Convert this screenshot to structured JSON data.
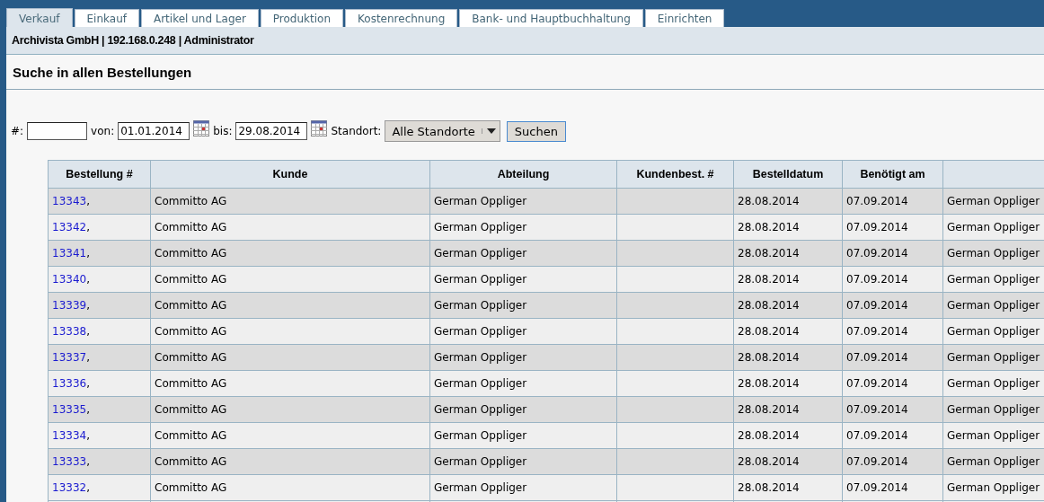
{
  "tabs": [
    {
      "label": "Verkauf",
      "selected": true
    },
    {
      "label": "Einkauf",
      "selected": false
    },
    {
      "label": "Artikel und Lager",
      "selected": false
    },
    {
      "label": "Produktion",
      "selected": false
    },
    {
      "label": "Kostenrechnung",
      "selected": false
    },
    {
      "label": "Bank- und Hauptbuchhaltung",
      "selected": false
    },
    {
      "label": "Einrichten",
      "selected": false
    }
  ],
  "info_bar": "Archivista GmbH | 192.168.0.248 | Administrator",
  "page_title": "Suche in allen Bestellungen",
  "search_form": {
    "number_label": "#:",
    "from_label": "von:",
    "from_value": "01.01.2014",
    "to_label": "bis:",
    "to_value": "29.08.2014",
    "location_label": "Standort:",
    "location_value": "Alle Standorte",
    "search_button": "Suchen"
  },
  "table": {
    "columns": [
      "Bestellung #",
      "Kunde",
      "Abteilung",
      "Kundenbest. #",
      "Bestelldatum",
      "Benötigt am"
    ],
    "rows": [
      {
        "number": "13343",
        "separator": ",",
        "customer": "Committo AG",
        "department": "German Oppliger",
        "order_date": "28.08.2014",
        "needed_by": "07.09.2014",
        "column_7": "German Oppliger"
      },
      {
        "number": "13342",
        "separator": ",",
        "customer": "Committo AG",
        "department": "German Oppliger",
        "order_date": "28.08.2014",
        "needed_by": "07.09.2014",
        "column_7": "German Oppliger"
      },
      {
        "number": "13341",
        "separator": ",",
        "customer": "Committo AG",
        "department": "German Oppliger",
        "order_date": "28.08.2014",
        "needed_by": "07.09.2014",
        "column_7": "German Oppliger"
      },
      {
        "number": "13340",
        "separator": ",",
        "customer": "Committo AG",
        "department": "German Oppliger",
        "order_date": "28.08.2014",
        "needed_by": "07.09.2014",
        "column_7": "German Oppliger"
      },
      {
        "number": "13339",
        "separator": ",",
        "customer": "Committo AG",
        "department": "German Oppliger",
        "order_date": "28.08.2014",
        "needed_by": "07.09.2014",
        "column_7": "German Oppliger"
      },
      {
        "number": "13338",
        "separator": ",",
        "customer": "Committo AG",
        "department": "German Oppliger",
        "order_date": "28.08.2014",
        "needed_by": "07.09.2014",
        "column_7": "German Oppliger"
      },
      {
        "number": "13337",
        "separator": ",",
        "customer": "Committo AG",
        "department": "German Oppliger",
        "order_date": "28.08.2014",
        "needed_by": "07.09.2014",
        "column_7": "German Oppliger"
      },
      {
        "number": "13336",
        "separator": ",",
        "customer": "Committo AG",
        "department": "German Oppliger",
        "order_date": "28.08.2014",
        "needed_by": "07.09.2014",
        "column_7": "German Oppliger"
      },
      {
        "number": "13335",
        "separator": ",",
        "customer": "Committo AG",
        "department": "German Oppliger",
        "order_date": "28.08.2014",
        "needed_by": "07.09.2014",
        "column_7": "German Oppliger"
      },
      {
        "number": "13334",
        "separator": ",",
        "customer": "Committo AG",
        "department": "German Oppliger",
        "order_date": "28.08.2014",
        "needed_by": "07.09.2014",
        "column_7": "German Oppliger"
      },
      {
        "number": "13333",
        "separator": ",",
        "customer": "Committo AG",
        "department": "German Oppliger",
        "order_date": "28.08.2014",
        "needed_by": "07.09.2014",
        "column_7": "German Oppliger"
      },
      {
        "number": "13332",
        "separator": ",",
        "customer": "Committo AG",
        "department": "German Oppliger",
        "order_date": "28.08.2014",
        "needed_by": "07.09.2014",
        "column_7": "German Oppliger"
      }
    ]
  }
}
